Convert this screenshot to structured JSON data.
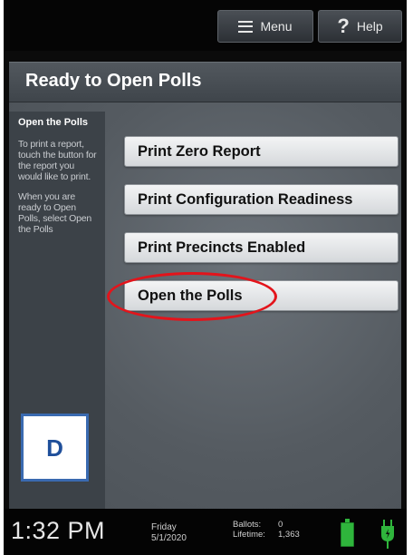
{
  "topbar": {
    "menu_label": "Menu",
    "help_label": "Help",
    "help_glyph": "?"
  },
  "header": {
    "title": "Ready to Open Polls"
  },
  "sidebar": {
    "title": "Open the Polls",
    "paragraph1": "To print a report, touch the button for the report you would like to print.",
    "paragraph2": "When you are ready to Open Polls, select Open the Polls"
  },
  "actions": [
    {
      "label": "Print Zero Report"
    },
    {
      "label": "Print Configuration Readiness"
    },
    {
      "label": "Print Precincts Enabled"
    },
    {
      "label": "Open the Polls"
    }
  ],
  "callout": {
    "letter": "D",
    "highlight_color": "#e3141b"
  },
  "status": {
    "time": "1:32 PM",
    "day": "Friday",
    "date": "5/1/2020",
    "ballots_label": "Ballots:",
    "ballots_value": "0",
    "lifetime_label": "Lifetime:",
    "lifetime_value": "1,363",
    "battery_icon": "battery-full-icon",
    "power_icon": "power-plug-icon",
    "accent_green": "#2fb53c"
  }
}
